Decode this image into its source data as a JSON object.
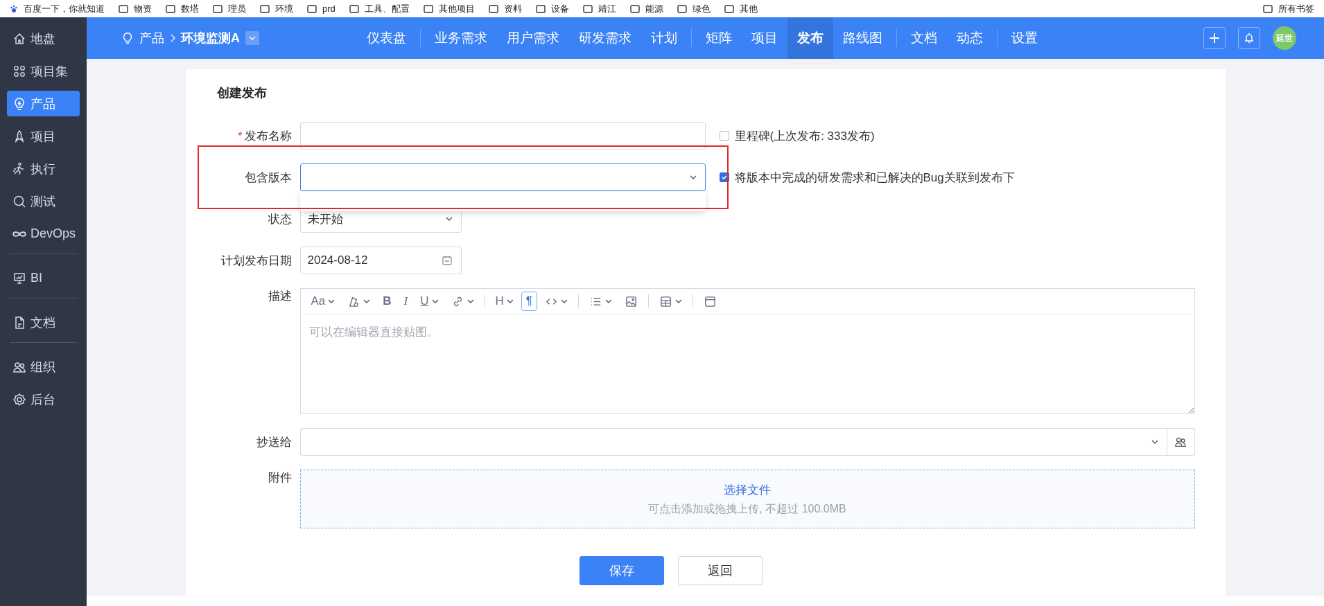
{
  "bookmarks": [
    {
      "kind": "site",
      "label": "百度一下，你就知道"
    },
    {
      "kind": "folder",
      "label": "物资"
    },
    {
      "kind": "folder",
      "label": "数塔"
    },
    {
      "kind": "folder",
      "label": "理员"
    },
    {
      "kind": "folder",
      "label": "环境"
    },
    {
      "kind": "folder",
      "label": "prd"
    },
    {
      "kind": "folder",
      "label": "工具、配置"
    },
    {
      "kind": "folder",
      "label": "其他项目"
    },
    {
      "kind": "folder",
      "label": "资料"
    },
    {
      "kind": "folder",
      "label": "设备"
    },
    {
      "kind": "folder",
      "label": "靖江"
    },
    {
      "kind": "folder",
      "label": "能源"
    },
    {
      "kind": "folder",
      "label": "绿色"
    },
    {
      "kind": "folder",
      "label": "其他"
    },
    {
      "kind": "all",
      "label": "所有书签"
    }
  ],
  "sidebar": {
    "groups": [
      [
        {
          "label": "地盘",
          "selected": false
        },
        {
          "label": "项目集",
          "selected": false
        },
        {
          "label": "产品",
          "selected": true
        },
        {
          "label": "项目",
          "selected": false
        },
        {
          "label": "执行",
          "selected": false
        },
        {
          "label": "测试",
          "selected": false
        },
        {
          "label": "DevOps",
          "selected": false
        }
      ],
      [
        {
          "label": "BI",
          "selected": false
        }
      ],
      [
        {
          "label": "文档",
          "selected": false
        }
      ],
      [
        {
          "label": "组织",
          "selected": false
        },
        {
          "label": "后台",
          "selected": false
        }
      ]
    ]
  },
  "breadcrumb": {
    "section": "产品",
    "product": "环境监测A"
  },
  "nav": {
    "groups": [
      [
        {
          "label": "仪表盘",
          "selected": false
        }
      ],
      [
        {
          "label": "业务需求",
          "selected": false
        },
        {
          "label": "用户需求",
          "selected": false
        },
        {
          "label": "研发需求",
          "selected": false
        },
        {
          "label": "计划",
          "selected": false
        }
      ],
      [
        {
          "label": "矩阵",
          "selected": false
        },
        {
          "label": "项目",
          "selected": false
        },
        {
          "label": "发布",
          "selected": true
        },
        {
          "label": "路线图",
          "selected": false
        }
      ],
      [
        {
          "label": "文档",
          "selected": false
        },
        {
          "label": "动态",
          "selected": false
        }
      ],
      [
        {
          "label": "设置",
          "selected": false
        }
      ]
    ]
  },
  "user": {
    "avatar": "延世"
  },
  "form": {
    "title": "创建发布",
    "name": {
      "label": "发布名称",
      "required_mark": "*",
      "milestone": {
        "label": "里程碑(上次发布: 333发布)",
        "checked": false
      }
    },
    "build": {
      "label": "包含版本",
      "expanded": true,
      "highlighted": true,
      "link": {
        "label": "将版本中完成的研发需求和已解决的Bug关联到发布下",
        "checked": true
      }
    },
    "status": {
      "label": "状态",
      "value": "未开始"
    },
    "date": {
      "label": "计划发布日期",
      "value": "2024-08-12"
    },
    "description": {
      "label": "描述",
      "placeholder": "可以在编辑器直接贴图。",
      "toolbar": [
        {
          "kind": "text",
          "label": "Aa",
          "caret": true,
          "selected": false
        },
        {
          "kind": "paint",
          "caret": true,
          "selected": false
        },
        {
          "kind": "text",
          "label": "B",
          "caret": false,
          "selected": false
        },
        {
          "kind": "text",
          "label": "I",
          "caret": false,
          "selected": false
        },
        {
          "kind": "text",
          "label": "U",
          "caret": true,
          "selected": false
        },
        {
          "kind": "link",
          "caret": true,
          "selected": false
        },
        {
          "kind": "separator"
        },
        {
          "kind": "text",
          "label": "H",
          "caret": true,
          "selected": false
        },
        {
          "kind": "text",
          "label": "¶",
          "caret": false,
          "selected": true
        },
        {
          "kind": "code",
          "caret": true,
          "selected": false
        },
        {
          "kind": "separator"
        },
        {
          "kind": "list",
          "caret": true,
          "selected": false
        },
        {
          "kind": "image",
          "caret": false,
          "selected": false
        },
        {
          "kind": "separator"
        },
        {
          "kind": "table",
          "caret": true,
          "selected": false
        },
        {
          "kind": "separator"
        },
        {
          "kind": "panel",
          "caret": false,
          "selected": false
        }
      ]
    },
    "cc": {
      "label": "抄送给"
    },
    "attachment": {
      "label": "附件",
      "action": "选择文件",
      "hint": "可点击添加或拖拽上传, 不超过 100.0MB"
    },
    "buttons": [
      {
        "kind": "primary",
        "label": "保存"
      },
      {
        "kind": "default",
        "label": "返回"
      }
    ]
  }
}
